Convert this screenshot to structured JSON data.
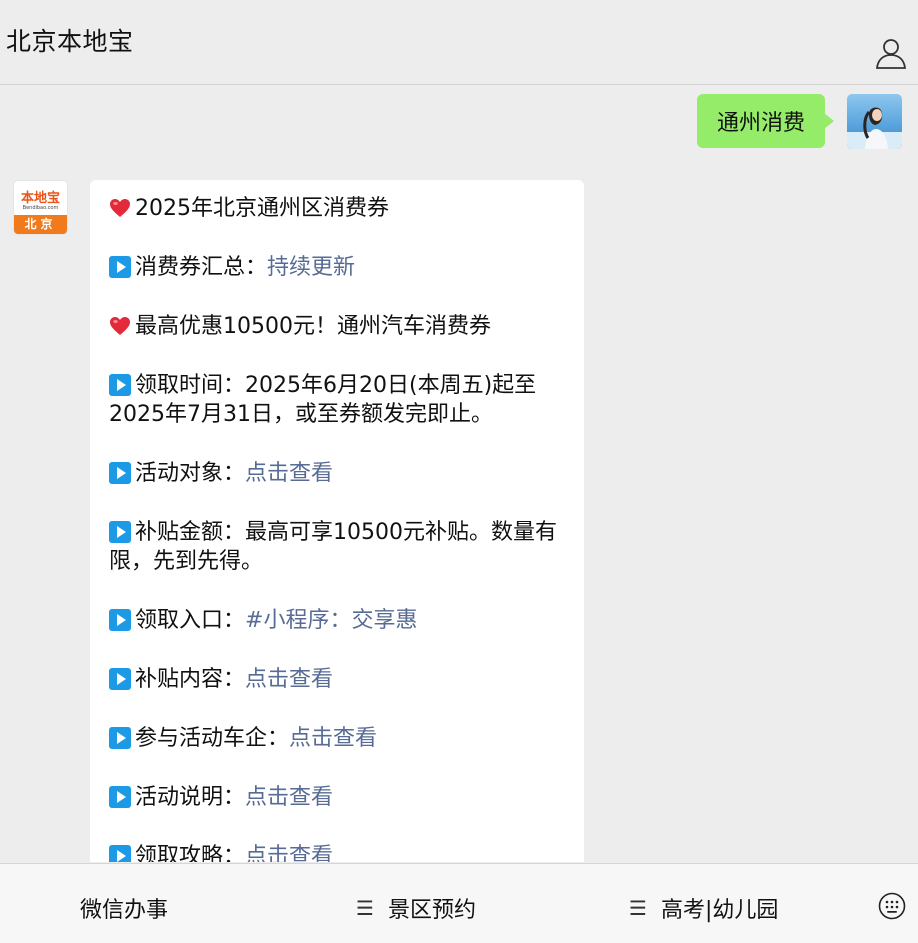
{
  "header": {
    "title": "北京本地宝",
    "profile_icon": "person-icon"
  },
  "chat": {
    "outgoing": {
      "text": "通州消费",
      "bubble_color": "#95ec69"
    },
    "incoming": {
      "lines": [
        {
          "icon": "heart-icon",
          "text": "2025年北京通州区消费券",
          "link": ""
        },
        {
          "icon": "play-icon",
          "text": "消费券汇总：",
          "link": "持续更新"
        },
        {
          "icon": "heart-icon",
          "text": "最高优惠10500元！通州汽车消费券",
          "link": ""
        },
        {
          "icon": "play-icon",
          "text": "领取时间：2025年6月20日(本周五)起至2025年7月31日，或至券额发完即止。",
          "link": ""
        },
        {
          "icon": "play-icon",
          "text": "活动对象：",
          "link": "点击查看"
        },
        {
          "icon": "play-icon",
          "text": "补贴金额：最高可享10500元补贴。数量有限，先到先得。",
          "link": ""
        },
        {
          "icon": "play-icon",
          "text": "领取入口：",
          "link": "#小程序：交享惠"
        },
        {
          "icon": "play-icon",
          "text": "补贴内容：",
          "link": "点击查看"
        },
        {
          "icon": "play-icon",
          "text": "参与活动车企：",
          "link": "点击查看"
        },
        {
          "icon": "play-icon",
          "text": "活动说明：",
          "link": "点击查看"
        },
        {
          "icon": "play-icon",
          "text": "领取攻略：",
          "link": "点击查看"
        }
      ]
    },
    "bot_avatar": {
      "logo_text": "本地宝",
      "logo_sub": "Bendibao.com",
      "band_text": "北京"
    }
  },
  "bottom_menu": {
    "items": [
      "微信办事",
      "景区预约",
      "高考|幼儿园"
    ],
    "menu_glyph": "☰",
    "keyboard_icon": "keyboard-icon"
  },
  "colors": {
    "link": "#576b95",
    "accent": "#1c9ae6",
    "heart": "#e4293b"
  }
}
